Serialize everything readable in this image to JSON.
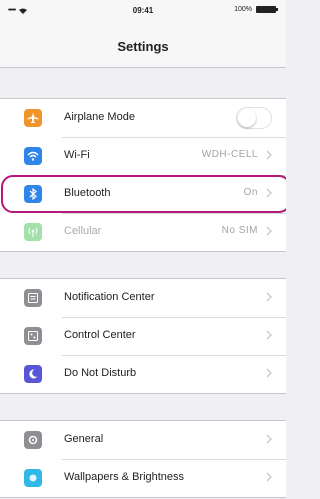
{
  "status_bar": {
    "carrier": "•••••",
    "time": "09:41",
    "battery": "100%"
  },
  "nav": {
    "title": "Settings"
  },
  "groups": [
    {
      "rows": [
        {
          "label": "Airplane Mode",
          "icon": "airplane-icon",
          "color": "#f0942c",
          "control": "toggle",
          "toggle_on": false
        },
        {
          "label": "Wi-Fi",
          "icon": "wifi-icon",
          "color": "#2f86e8",
          "value": "WDH-CELL"
        },
        {
          "label": "Bluetooth",
          "icon": "bluetooth-icon",
          "color": "#2f86e8",
          "value": "On"
        },
        {
          "label": "Cellular",
          "icon": "cellular-icon",
          "color": "#58c866",
          "value": "No SIM",
          "disabled": true
        }
      ]
    },
    {
      "rows": [
        {
          "label": "Notification Center",
          "icon": "notification-center-icon",
          "color": "#8e8e93"
        },
        {
          "label": "Control Center",
          "icon": "control-center-icon",
          "color": "#8e8e93"
        },
        {
          "label": "Do Not Disturb",
          "icon": "moon-icon",
          "color": "#5856d6"
        }
      ]
    },
    {
      "rows": [
        {
          "label": "General",
          "icon": "gear-icon",
          "color": "#8e8e93"
        },
        {
          "label": "Wallpapers & Brightness",
          "icon": "wallpaper-icon",
          "color": "#2fb8e8"
        }
      ]
    }
  ],
  "highlight": {
    "color": "#b5177b",
    "target": "Bluetooth"
  }
}
